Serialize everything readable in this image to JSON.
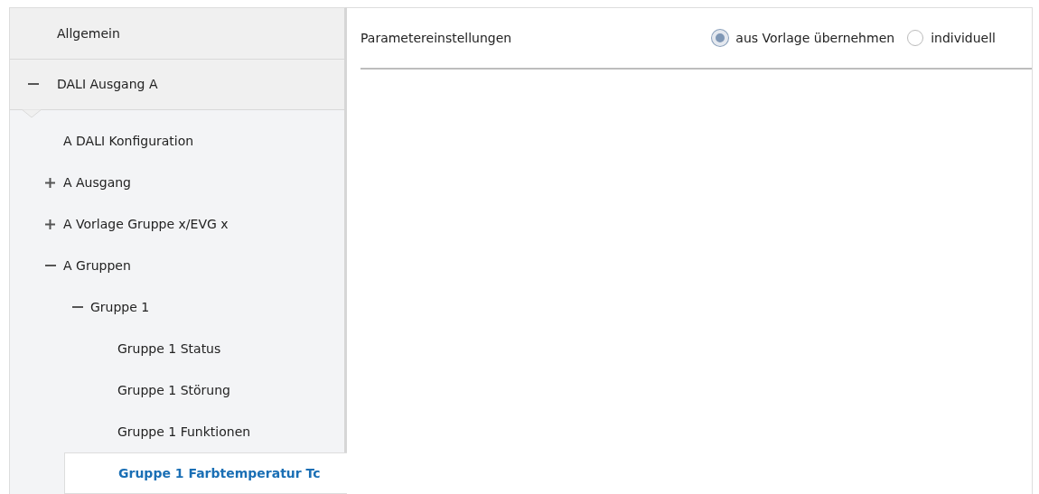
{
  "sidebar": {
    "sections": [
      {
        "label": "Allgemein",
        "selected": false
      },
      {
        "label": "DALI Ausgang A",
        "selected": false,
        "expanded": true,
        "children": [
          {
            "label": "A DALI Konfiguration",
            "selected": false
          },
          {
            "label": "A Ausgang",
            "selected": false,
            "expanded": false
          },
          {
            "label": "A Vorlage Gruppe x/EVG x",
            "selected": false,
            "expanded": false
          },
          {
            "label": "A Gruppen",
            "selected": false,
            "expanded": true,
            "children": [
              {
                "label": "Gruppe 1",
                "selected": false,
                "expanded": true,
                "children": [
                  {
                    "label": "Gruppe 1 Status",
                    "selected": false
                  },
                  {
                    "label": "Gruppe 1 Störung",
                    "selected": false
                  },
                  {
                    "label": "Gruppe 1 Funktionen",
                    "selected": false
                  },
                  {
                    "label": "Gruppe 1 Farbtemperatur Tc",
                    "selected": true
                  }
                ]
              }
            ]
          }
        ]
      }
    ]
  },
  "parameter": {
    "label": "Parametereinstellungen",
    "options": [
      {
        "label": "aus Vorlage übernehmen",
        "selected": true
      },
      {
        "label": "individuell",
        "selected": false
      }
    ]
  }
}
